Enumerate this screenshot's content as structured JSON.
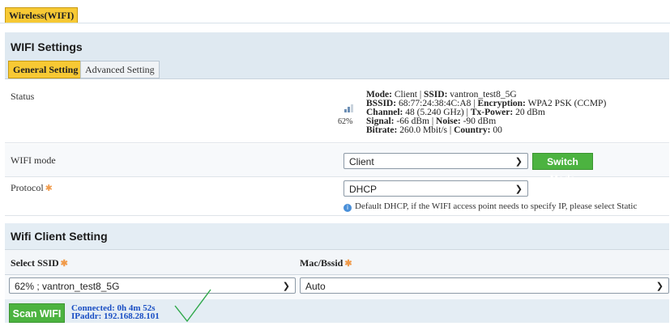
{
  "top_tab": "Wireless(WIFI)",
  "wifi_settings": {
    "title": "WIFI Settings",
    "tabs": [
      "General Setting",
      "Advanced Setting"
    ]
  },
  "status": {
    "label": "Status",
    "signal_percent": "62%",
    "mode_label": "Mode:",
    "mode": "Client",
    "ssid_label": "SSID:",
    "ssid": "vantron_test8_5G",
    "bssid_label": "BSSID:",
    "bssid": "68:77:24:38:4C:A8",
    "encryption_label": "Encryption:",
    "encryption": "WPA2 PSK (CCMP)",
    "channel_label": "Channel:",
    "channel": "48 (5.240 GHz)",
    "txpower_label": "Tx-Power:",
    "txpower": "20 dBm",
    "signal_label": "Signal:",
    "signal": "-66 dBm",
    "noise_label": "Noise:",
    "noise": "-90 dBm",
    "bitrate_label": "Bitrate:",
    "bitrate": "260.0 Mbit/s",
    "country_label": "Country:",
    "country": "00"
  },
  "wifi_mode": {
    "label": "WIFI mode",
    "value": "Client",
    "button": "Switch Mode"
  },
  "protocol": {
    "label": "Protocol",
    "value": "DHCP",
    "hint": "Default DHCP, if the WIFI access point needs to specify IP, please select Static"
  },
  "client": {
    "title": "Wifi Client Setting",
    "ssid_label": "Select SSID",
    "mac_label": "Mac/Bssid",
    "ssid_value": "62% ; vantron_test8_5G",
    "mac_value": "Auto",
    "scan_button": "Scan WIFI",
    "connected": "Connected: 0h 4m 52s",
    "ipaddr": "IPaddr: 192.168.28.101"
  },
  "colors": {
    "accent_tab": "#f7c934",
    "button_green": "#4cb340",
    "link_blue": "#1a4fc4"
  }
}
